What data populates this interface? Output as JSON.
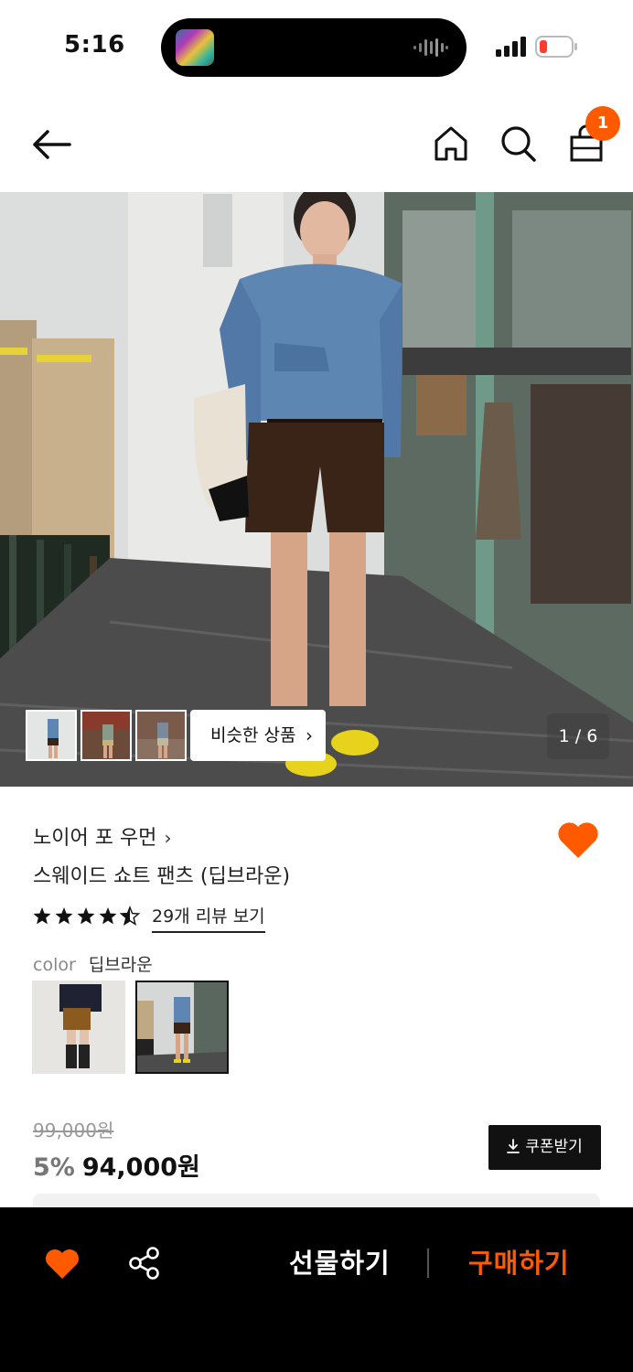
{
  "status_bar": {
    "time": "5:16"
  },
  "nav": {
    "cart_count": "1"
  },
  "gallery": {
    "similar_label": "비슷한 상품",
    "page_indicator": "1 / 6"
  },
  "product": {
    "brand": "노이어 포 우먼",
    "name": "스웨이드 쇼트 팬츠 (딥브라운)",
    "rating": 4.5,
    "review_link": "29개 리뷰 보기",
    "color_label": "color",
    "color_value": "딥브라운",
    "original_price": "99,000원",
    "discount": "5%",
    "sale_price": "94,000원",
    "coupon_label": "쿠폰받기"
  },
  "bottom_bar": {
    "gift_label": "선물하기",
    "buy_label": "구매하기"
  },
  "colors": {
    "accent": "#ff5a00",
    "dark": "#111111"
  }
}
